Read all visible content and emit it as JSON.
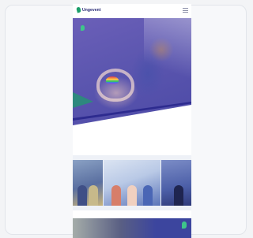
{
  "header": {
    "logo_text": "Ungevent",
    "menu_icon": "hamburger-icon"
  },
  "hero": {
    "caption_lines": [
      "",
      ""
    ],
    "caption_mark_icon": "speech-drop-icon"
  },
  "intro": {
    "text": ""
  },
  "cards": [
    {
      "label": ""
    },
    {
      "label": ""
    },
    {
      "label": ""
    }
  ],
  "news": {
    "text": "",
    "mark_icon": "speech-drop-icon"
  },
  "colors": {
    "brand_green": "#1c9f6a",
    "brand_navy": "#1d1f6e",
    "hero_purple": "#5d57b0"
  }
}
